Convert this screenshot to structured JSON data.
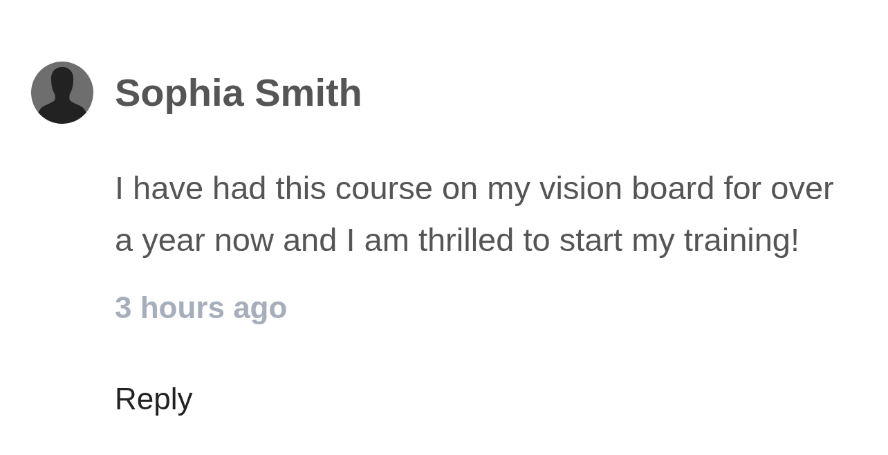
{
  "comment": {
    "author": "Sophia Smith",
    "text": "I have had this course on my vision board for over a year now and I am thrilled to start my training!",
    "time": "3 hours ago"
  },
  "reply_link": {
    "label": "Reply"
  }
}
